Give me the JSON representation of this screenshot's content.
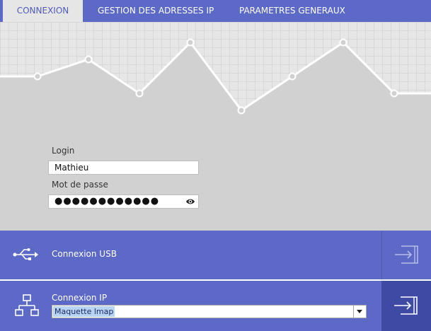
{
  "tabs": [
    {
      "label": "CONNEXION",
      "active": true
    },
    {
      "label": "GESTION DES ADRESSES IP",
      "active": false
    },
    {
      "label": "PARAMETRES GENERAUX",
      "active": false
    }
  ],
  "login": {
    "login_label": "Login",
    "login_value": "Mathieu",
    "password_label": "Mot de passe",
    "password_value": "●●●●●●●●●●●●"
  },
  "usb": {
    "label": "Connexion USB",
    "icon": "usb-icon",
    "action_icon": "connect-icon"
  },
  "ip": {
    "label": "Connexion IP",
    "selected": "Maquette lmap",
    "icon": "network-icon",
    "action_icon": "connect-icon"
  },
  "colors": {
    "accent": "#5d69c6",
    "accent_dark": "#3e4aa3",
    "background": "#d1d1d1",
    "tab_active_bg": "#e6e6e6"
  }
}
